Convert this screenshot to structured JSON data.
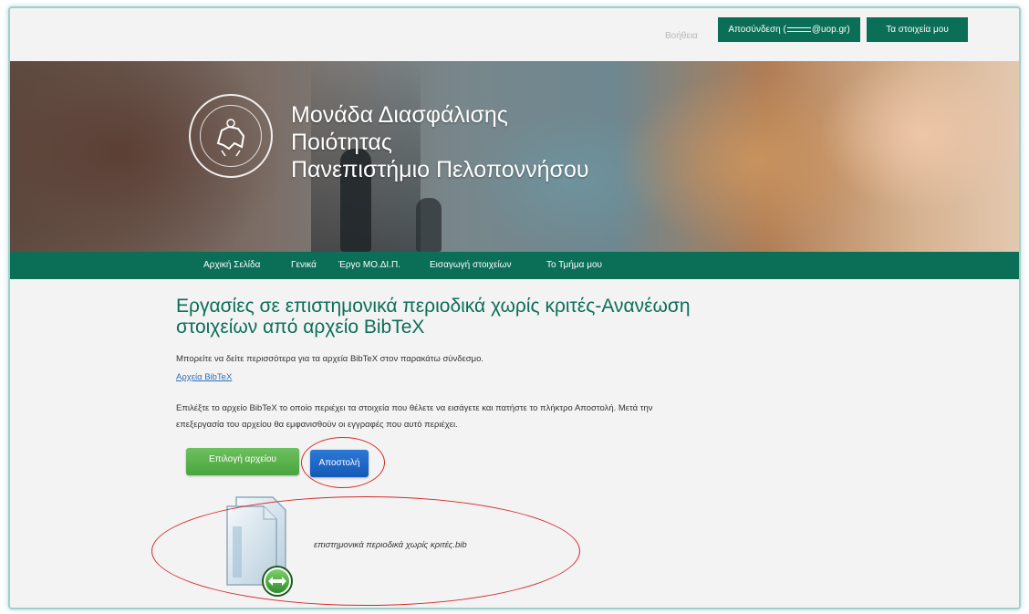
{
  "topbar": {
    "help": "Βοήθεια",
    "logout_prefix": "Αποσύνδεση (",
    "logout_suffix": "@uop.gr)",
    "profile": "Τα στοιχεία μου"
  },
  "hero": {
    "title_lines": [
      "Μονάδα Διασφάλισης",
      "Ποιότητας",
      "Πανεπιστήμιο Πελοποννήσου"
    ]
  },
  "nav": {
    "items": [
      {
        "label": "Αρχική Σελίδα"
      },
      {
        "label": "Γενικά"
      },
      {
        "label": "Έργο ΜΟ.ΔΙ.Π."
      },
      {
        "label": "Εισαγωγή στοιχείων"
      },
      {
        "label": "Το Τμήμα μου"
      }
    ]
  },
  "main": {
    "title": "Εργασίες σε επιστημονικά περιοδικά χωρίς κριτές-Ανανέωση στοιχείων από αρχείο BibTeX",
    "info_text": "Μπορείτε να δείτε περισσότερα για τα αρχεία BibTeX στον παρακάτω σύνδεσμο.",
    "link_text": "Αρχεία BibTeX",
    "instructions_line1": "Επιλέξτε το αρχείο BibTeX το οποίο περιέχει τα στοιχεία που θέλετε να εισάγετε και πατήστε το πλήκτρο Αποστολή. Μετά την",
    "instructions_line2": "επεξεργασία του αρχείου θα εμφανισθούν οι εγγραφές που αυτό περιέχει.",
    "choose_file": "Επιλογή αρχείου",
    "send": "Αποστολή",
    "file_name": "επιστημονικά περιοδικά χωρίς κριτές.bib"
  },
  "colors": {
    "brand_green": "#0b6e57",
    "annotation_red": "#d62828",
    "choose_button": "#4aa53d",
    "send_button": "#1458b8"
  }
}
